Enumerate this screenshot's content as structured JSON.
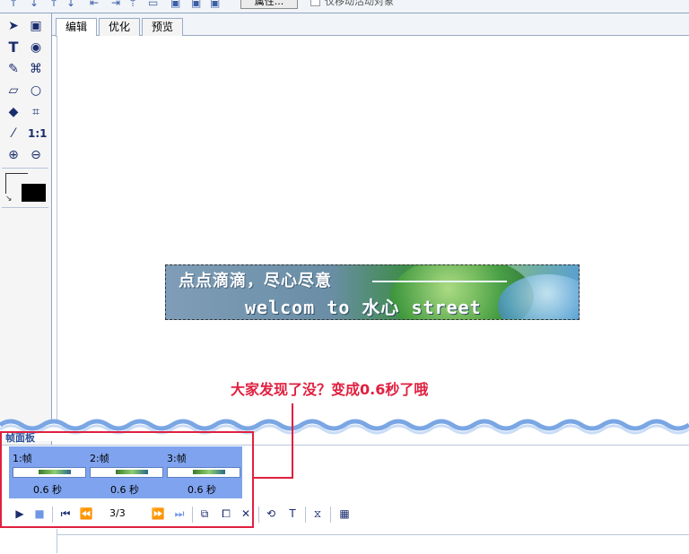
{
  "toolbar": {
    "properties_button": "属性...",
    "checkbox_label": "仅移动活动对象",
    "icons": [
      "arrow-up-icon",
      "arrow-down-icon",
      "arrow-up-icon",
      "arrow-down-bar-icon",
      "align-left-icon",
      "align-right-icon",
      "align-top-icon",
      "layout-icon",
      "layout-icon",
      "layout-icon"
    ]
  },
  "tools": {
    "items": [
      "pointer-icon",
      "select-region-icon",
      "text-icon",
      "rotate-icon",
      "brush-icon",
      "lasso-icon",
      "eraser-icon",
      "ellipse-select-icon",
      "paint-bucket-icon",
      "crop-icon",
      "eyedropper-icon",
      "actual-size-icon",
      "zoom-in-icon",
      "zoom-out-icon"
    ],
    "stroke_color": "#ffffff",
    "fill_color": "#000000"
  },
  "tabs": [
    "编辑",
    "优化",
    "预览"
  ],
  "banner": {
    "line1": "点点滴滴，尽心尽意",
    "line2": "welcom to 水心 street"
  },
  "annotation": {
    "text": "大家发现了没？变成0.6秒了哦",
    "color": "#e02040"
  },
  "frames_panel": {
    "title": "帧面板",
    "frames": [
      {
        "label": "1:帧",
        "delay": "0.6 秒"
      },
      {
        "label": "2:帧",
        "delay": "0.6 秒"
      },
      {
        "label": "3:帧",
        "delay": "0.6 秒"
      }
    ],
    "counter": "3/3"
  }
}
